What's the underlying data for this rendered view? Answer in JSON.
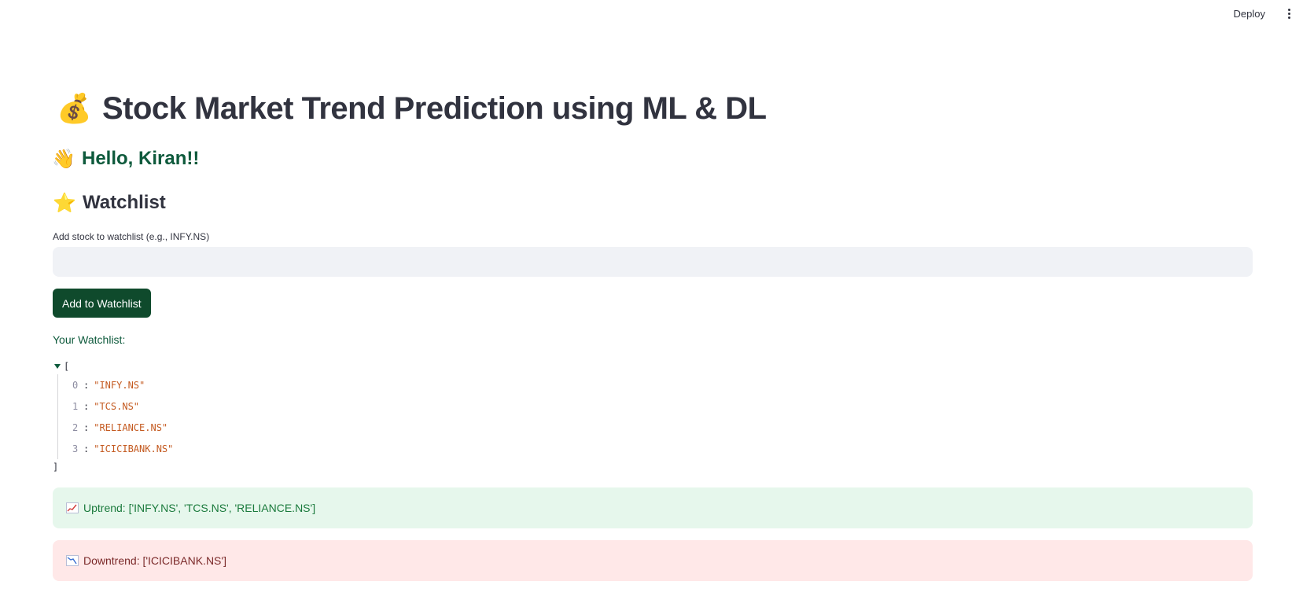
{
  "topbar": {
    "deploy_label": "Deploy",
    "menu_icon": "more-vertical-icon"
  },
  "header": {
    "title_emoji": "💰",
    "title": "Stock Market Trend Prediction using ML & DL",
    "greeting_emoji": "👋",
    "greeting": "Hello, Kiran!!"
  },
  "watchlist": {
    "heading_emoji": "⭐",
    "heading": "Watchlist",
    "input_label": "Add stock to watchlist (e.g., INFY.NS)",
    "input_value": "",
    "input_placeholder": "",
    "add_button_label": "Add to Watchlist",
    "list_label": "Your Watchlist:",
    "json_open": "[",
    "json_close": "]",
    "items": [
      {
        "index": "0",
        "value": "\"INFY.NS\""
      },
      {
        "index": "1",
        "value": "\"TCS.NS\""
      },
      {
        "index": "2",
        "value": "\"RELIANCE.NS\""
      },
      {
        "index": "3",
        "value": "\"ICICIBANK.NS\""
      }
    ]
  },
  "alerts": {
    "uptrend": {
      "icon": "chart-increasing-icon",
      "text": "Uptrend: ['INFY.NS', 'TCS.NS', 'RELIANCE.NS']"
    },
    "downtrend": {
      "icon": "chart-decreasing-icon",
      "text": "Downtrend: ['ICICIBANK.NS']"
    }
  },
  "colors": {
    "primary_button": "#0f4a2c",
    "greeting_text": "#0e5a3c",
    "success_bg": "#e6f7ec",
    "success_text": "#1a7a3c",
    "error_bg": "#ffe8e8",
    "error_text": "#7a2828",
    "json_string": "#c45a20"
  }
}
